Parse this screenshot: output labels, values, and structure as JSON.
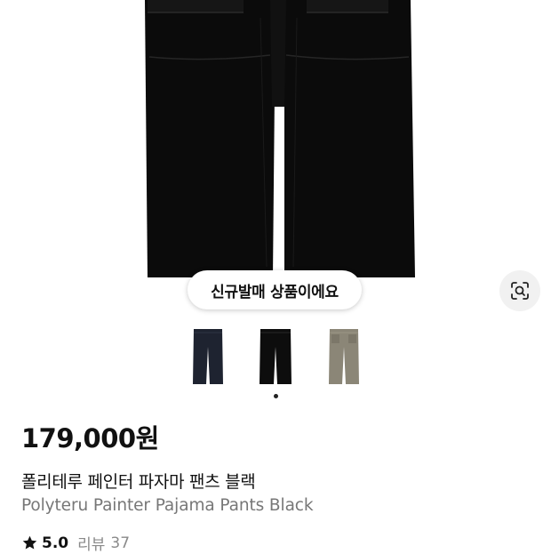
{
  "product": {
    "badge": "신규발매 상품이에요",
    "price": "179,000원",
    "name_ko": "폴리테루 페인터 파자마 팬츠 블랙",
    "name_en": "Polyteru Painter Pajama Pants Black",
    "rating": "5.0",
    "review_label": "리뷰",
    "review_count": "37"
  },
  "thumbnails": [
    {
      "color_name": "navy",
      "color": "#1e2330"
    },
    {
      "color_name": "black",
      "color": "#0d0d0d"
    },
    {
      "color_name": "khaki-gray",
      "color": "#8b8677"
    }
  ],
  "carousel": {
    "current": 1,
    "total": 1
  },
  "icons": {
    "image_search": "lens-search-icon",
    "rating": "star-icon"
  },
  "colors": {
    "pants": "#0b0b0b",
    "badge_bg": "#ffffff",
    "secondary_text": "#777777"
  }
}
